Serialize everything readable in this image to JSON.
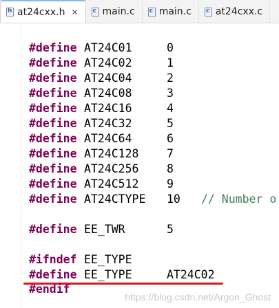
{
  "tabs": [
    {
      "label": "at24cxx.h",
      "icon": "h",
      "close": "✕",
      "active": true
    },
    {
      "label": "main.c",
      "icon": "c"
    },
    {
      "label": "main.c",
      "icon": "c"
    },
    {
      "label": "at24cxx.c",
      "icon": "c"
    }
  ],
  "code": {
    "define_kw": "#define",
    "ifndef_kw": "#ifndef",
    "endif_kw": "#endif",
    "rows": [
      {
        "name": "AT24C01",
        "value": "0"
      },
      {
        "name": "AT24C02",
        "value": "1"
      },
      {
        "name": "AT24C04",
        "value": "2"
      },
      {
        "name": "AT24C08",
        "value": "3"
      },
      {
        "name": "AT24C16",
        "value": "4"
      },
      {
        "name": "AT24C32",
        "value": "5"
      },
      {
        "name": "AT24C64",
        "value": "6"
      },
      {
        "name": "AT24C128",
        "value": "7"
      },
      {
        "name": "AT24C256",
        "value": "8"
      },
      {
        "name": "AT24C512",
        "value": "9"
      },
      {
        "name": "AT24CTYPE",
        "value": "10",
        "comment": "// Number o"
      }
    ],
    "ee_twr": {
      "name": "EE_TWR",
      "value": "5"
    },
    "ifndef_name": "EE_TYPE",
    "ee_type": {
      "name": "EE_TYPE",
      "value": "AT24C02"
    }
  },
  "watermark": "https://blog.csdn.net/Argon_Ghost",
  "colors": {
    "keyword": "#7f0055",
    "comment": "#3f7f5f",
    "underline": "#e0141b"
  }
}
